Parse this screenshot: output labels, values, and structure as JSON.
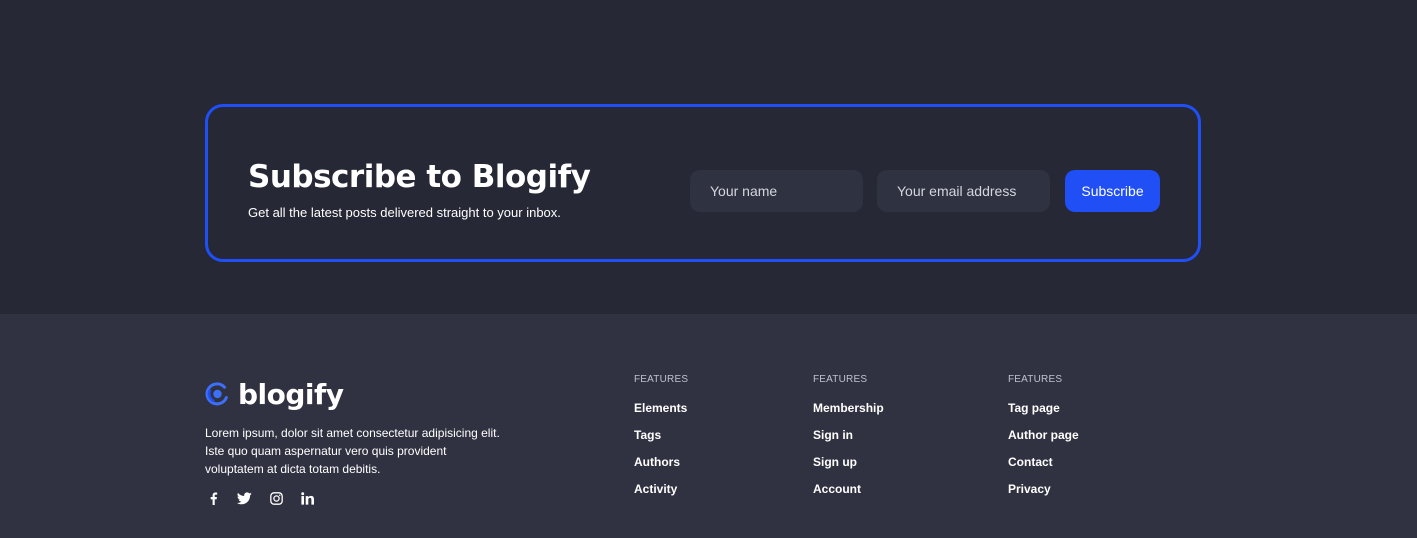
{
  "subscribe": {
    "title": "Subscribe to Blogify",
    "subtitle": "Get all the latest posts delivered straight to your inbox.",
    "name_placeholder": "Your name",
    "email_placeholder": "Your email address",
    "button_label": "Subscribe"
  },
  "footer": {
    "brand_name": "blogify",
    "logo_icon": "blogify-logo-icon",
    "about": "Lorem ipsum, dolor sit amet consectetur adipisicing elit. Iste quo quam aspernatur vero quis provident voluptatem at dicta totam debitis.",
    "socials": [
      "facebook-icon",
      "twitter-icon",
      "instagram-icon",
      "linkedin-icon"
    ],
    "columns": [
      {
        "heading": "FEATURES",
        "links": [
          "Elements",
          "Tags",
          "Authors",
          "Activity"
        ]
      },
      {
        "heading": "FEATURES",
        "links": [
          "Membership",
          "Sign in",
          "Sign up",
          "Account"
        ]
      },
      {
        "heading": "FEATURES",
        "links": [
          "Tag page",
          "Author page",
          "Contact",
          "Privacy"
        ]
      }
    ]
  },
  "colors": {
    "accent": "#1f4ff5",
    "page_background": "#262835",
    "footer_background": "#303241",
    "input_background": "#2f3240"
  }
}
